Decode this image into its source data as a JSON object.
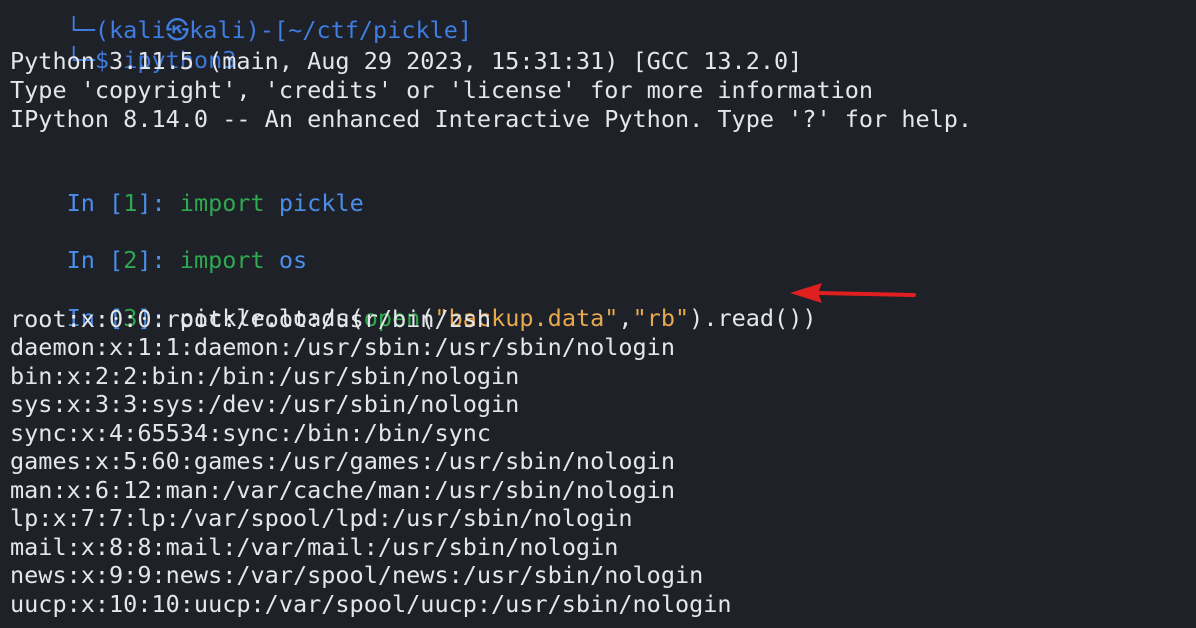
{
  "colors": {
    "background": "#1e2128",
    "prompt_blue": "#4a8ee8",
    "keyword_green": "#2fa84f",
    "string_orange": "#e8a94d",
    "text": "#e4e6ea",
    "arrow_red": "#e02020"
  },
  "header": {
    "top_prompt_partial": "└─(kali㉿kali)-[~/ctf/pickle]",
    "cmd_prefix": "└─$ ",
    "cmd": "ipython3"
  },
  "banner": {
    "line1": "Python 3.11.5 (main, Aug 29 2023, 15:31:31) [GCC 13.2.0]",
    "line2": "Type 'copyright', 'credits' or 'license' for more information",
    "line3": "IPython 8.14.0 -- An enhanced Interactive Python. Type '?' for help."
  },
  "cells": [
    {
      "in_label": "In [",
      "num": "1",
      "close": "]: ",
      "keyword": "import",
      "module": "pickle"
    },
    {
      "in_label": "In [",
      "num": "2",
      "close": "]: ",
      "keyword": "import",
      "module": "os"
    }
  ],
  "cell3": {
    "in_label": "In [",
    "num": "3",
    "close": "]: ",
    "code_a": "pickle.loads(",
    "builtin": "open",
    "paren": "(",
    "str1": "\"backup.data\"",
    "comma": ",",
    "str2": "\"rb\"",
    "code_b": ").read())"
  },
  "output": [
    "root:x:0:0:root:/root:/usr/bin/zsh",
    "daemon:x:1:1:daemon:/usr/sbin:/usr/sbin/nologin",
    "bin:x:2:2:bin:/bin:/usr/sbin/nologin",
    "sys:x:3:3:sys:/dev:/usr/sbin/nologin",
    "sync:x:4:65534:sync:/bin:/bin/sync",
    "games:x:5:60:games:/usr/games:/usr/sbin/nologin",
    "man:x:6:12:man:/var/cache/man:/usr/sbin/nologin",
    "lp:x:7:7:lp:/var/spool/lpd:/usr/sbin/nologin",
    "mail:x:8:8:mail:/var/mail:/usr/sbin/nologin",
    "news:x:9:9:news:/var/spool/news:/usr/sbin/nologin",
    "uucp:x:10:10:uucp:/var/spool/uucp:/usr/sbin/nologin"
  ],
  "icons": {
    "arrow": "red-arrow-icon"
  }
}
